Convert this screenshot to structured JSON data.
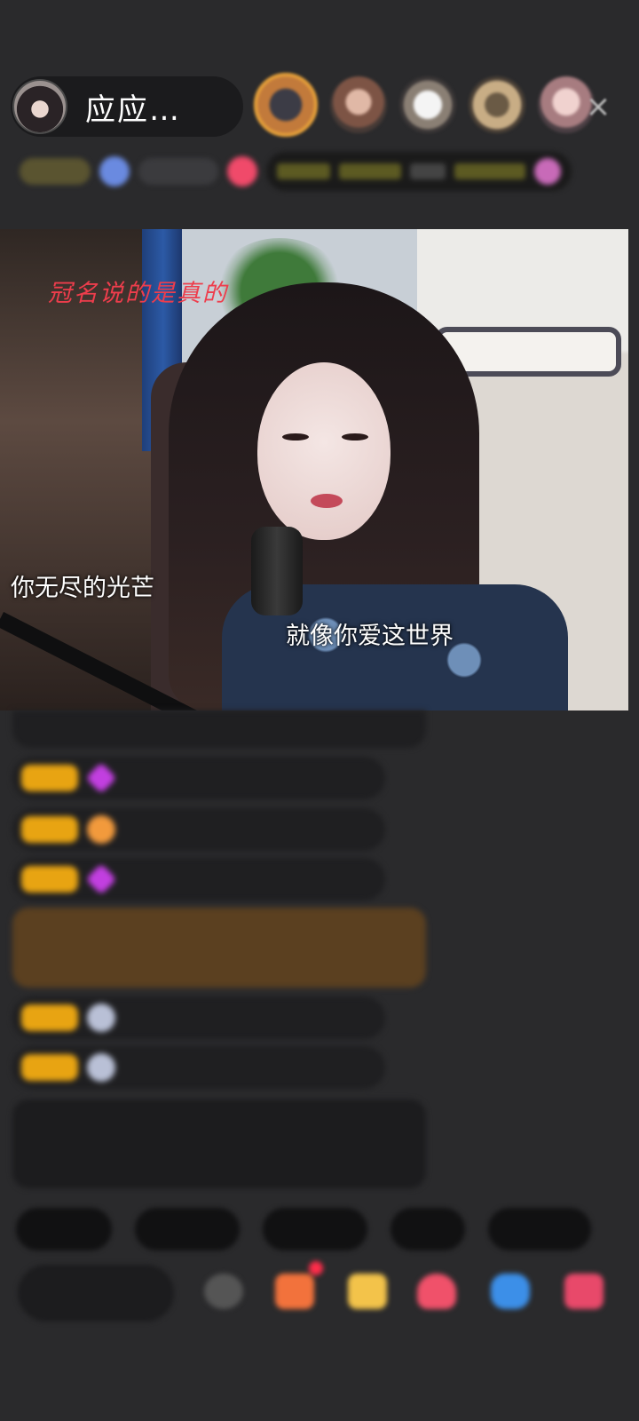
{
  "header": {
    "host_name": "应应…",
    "close_label": "×",
    "viewer_avatars": [
      "viewer-1",
      "viewer-2",
      "viewer-3",
      "viewer-4",
      "viewer-5"
    ],
    "info_chips": [
      " ",
      " ",
      " "
    ],
    "ranking_text": [
      " ",
      " ",
      " ",
      " "
    ]
  },
  "video": {
    "red_caption": "冠名说的是真的",
    "lyric_left": "你无尽的光芒",
    "lyric_right": "就像你爱这世界"
  },
  "chat": {
    "messages": [
      {
        "badge": " ",
        "user": " ",
        "text": " "
      },
      {
        "badge": " ",
        "user": " ",
        "text": " "
      },
      {
        "badge": " ",
        "user": " ",
        "text": " "
      },
      {
        "badge": " ",
        "user": " ",
        "text": " "
      },
      {
        "badge": " ",
        "user": " ",
        "text": " "
      },
      {
        "badge": " ",
        "user": " ",
        "text": " "
      }
    ],
    "system_notice": " "
  },
  "quick_replies": [
    " ",
    " ",
    " ",
    " ",
    " "
  ],
  "bottom_bar": {
    "input_placeholder": " ",
    "icons": [
      "emoji-icon",
      "treasure-box-icon",
      "gift-icon",
      "heart-icon",
      "game-icon",
      "more-icon"
    ]
  },
  "colors": {
    "background": "#2a2a2c",
    "badge": "#e8a412",
    "red_caption": "#ee3d4c",
    "system_text": "#8fd36a"
  }
}
